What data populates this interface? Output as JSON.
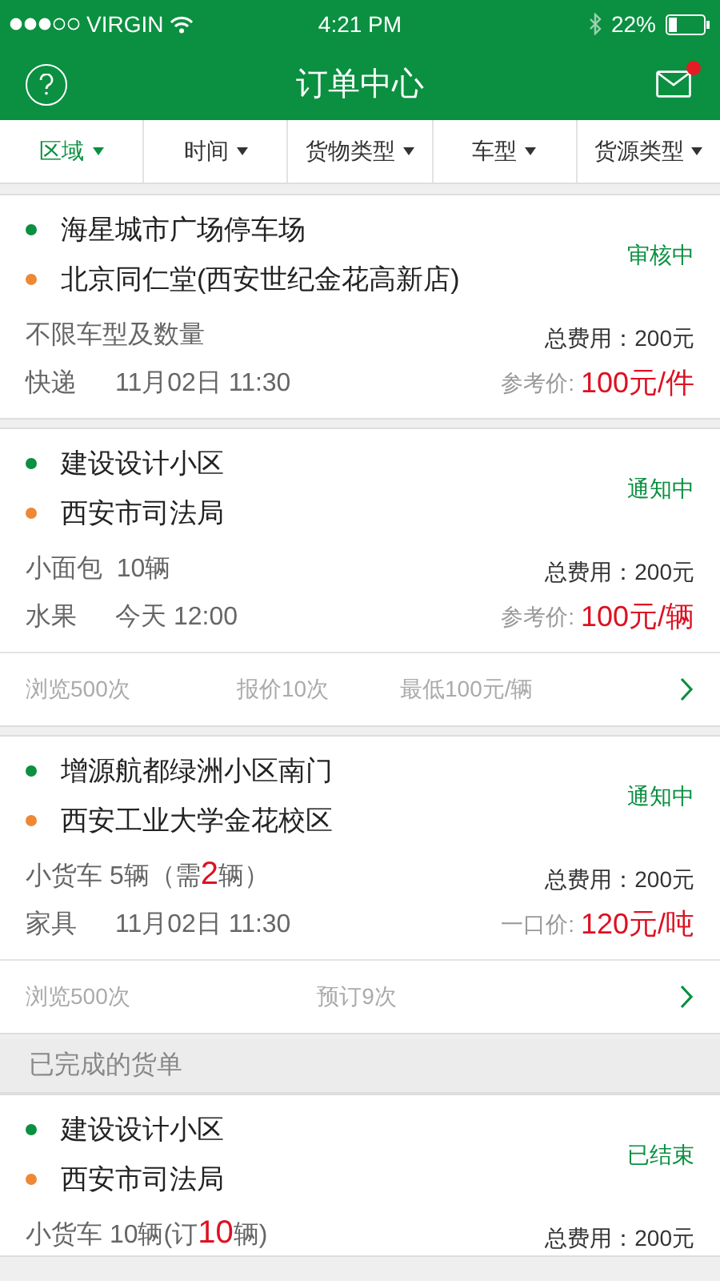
{
  "status_bar": {
    "carrier": "VIRGIN",
    "time": "4:21 PM",
    "battery": "22%"
  },
  "header": {
    "title": "订单中心",
    "has_unread": true
  },
  "filters": [
    {
      "label": "区域",
      "selected": true
    },
    {
      "label": "时间",
      "selected": false
    },
    {
      "label": "货物类型",
      "selected": false
    },
    {
      "label": "车型",
      "selected": false
    },
    {
      "label": "货源类型",
      "selected": false
    }
  ],
  "sections": [
    {
      "orders": [
        {
          "from": "海星城市广场停车场",
          "to": "北京同仁堂(西安世纪金花高新店)",
          "status": "审核中",
          "vehicle": [
            {
              "kind": "plain",
              "text": "不限车型及数量"
            }
          ],
          "cargo": "快递",
          "time": "11月02日 11:30",
          "total": "总费用：200元",
          "price_label": "参考价:",
          "price": "100元/件"
        },
        {
          "from": "建设设计小区",
          "to": "西安市司法局",
          "status": "通知中",
          "vehicle": [
            {
              "kind": "plain",
              "text": "小面包  10辆"
            }
          ],
          "cargo": "水果",
          "time": "今天 12:00",
          "total": "总费用：200元",
          "price_label": "参考价:",
          "price": "100元/辆",
          "stats": [
            "浏览500次",
            "报价10次",
            "最低100元/辆"
          ]
        },
        {
          "from": "增源航都绿洲小区南门",
          "to": "西安工业大学金花校区",
          "status": "通知中",
          "vehicle": [
            {
              "kind": "plain",
              "text": "小货车 5辆（需"
            },
            {
              "kind": "highlight",
              "text": "2"
            },
            {
              "kind": "plain",
              "text": "辆）"
            }
          ],
          "cargo": "家具",
          "time": "11月02日 11:30",
          "total": "总费用：200元",
          "price_label": "一口价:",
          "price": "120元/吨",
          "stats": [
            "浏览500次",
            "预订9次"
          ]
        }
      ]
    },
    {
      "title": "已完成的货单",
      "orders": [
        {
          "from": "建设设计小区",
          "to": "西安市司法局",
          "status": "已结束",
          "vehicle": [
            {
              "kind": "plain",
              "text": "小货车 10辆(订"
            },
            {
              "kind": "highlight",
              "text": "10"
            },
            {
              "kind": "plain",
              "text": "辆)"
            }
          ],
          "total": "总费用：200元"
        }
      ]
    }
  ]
}
